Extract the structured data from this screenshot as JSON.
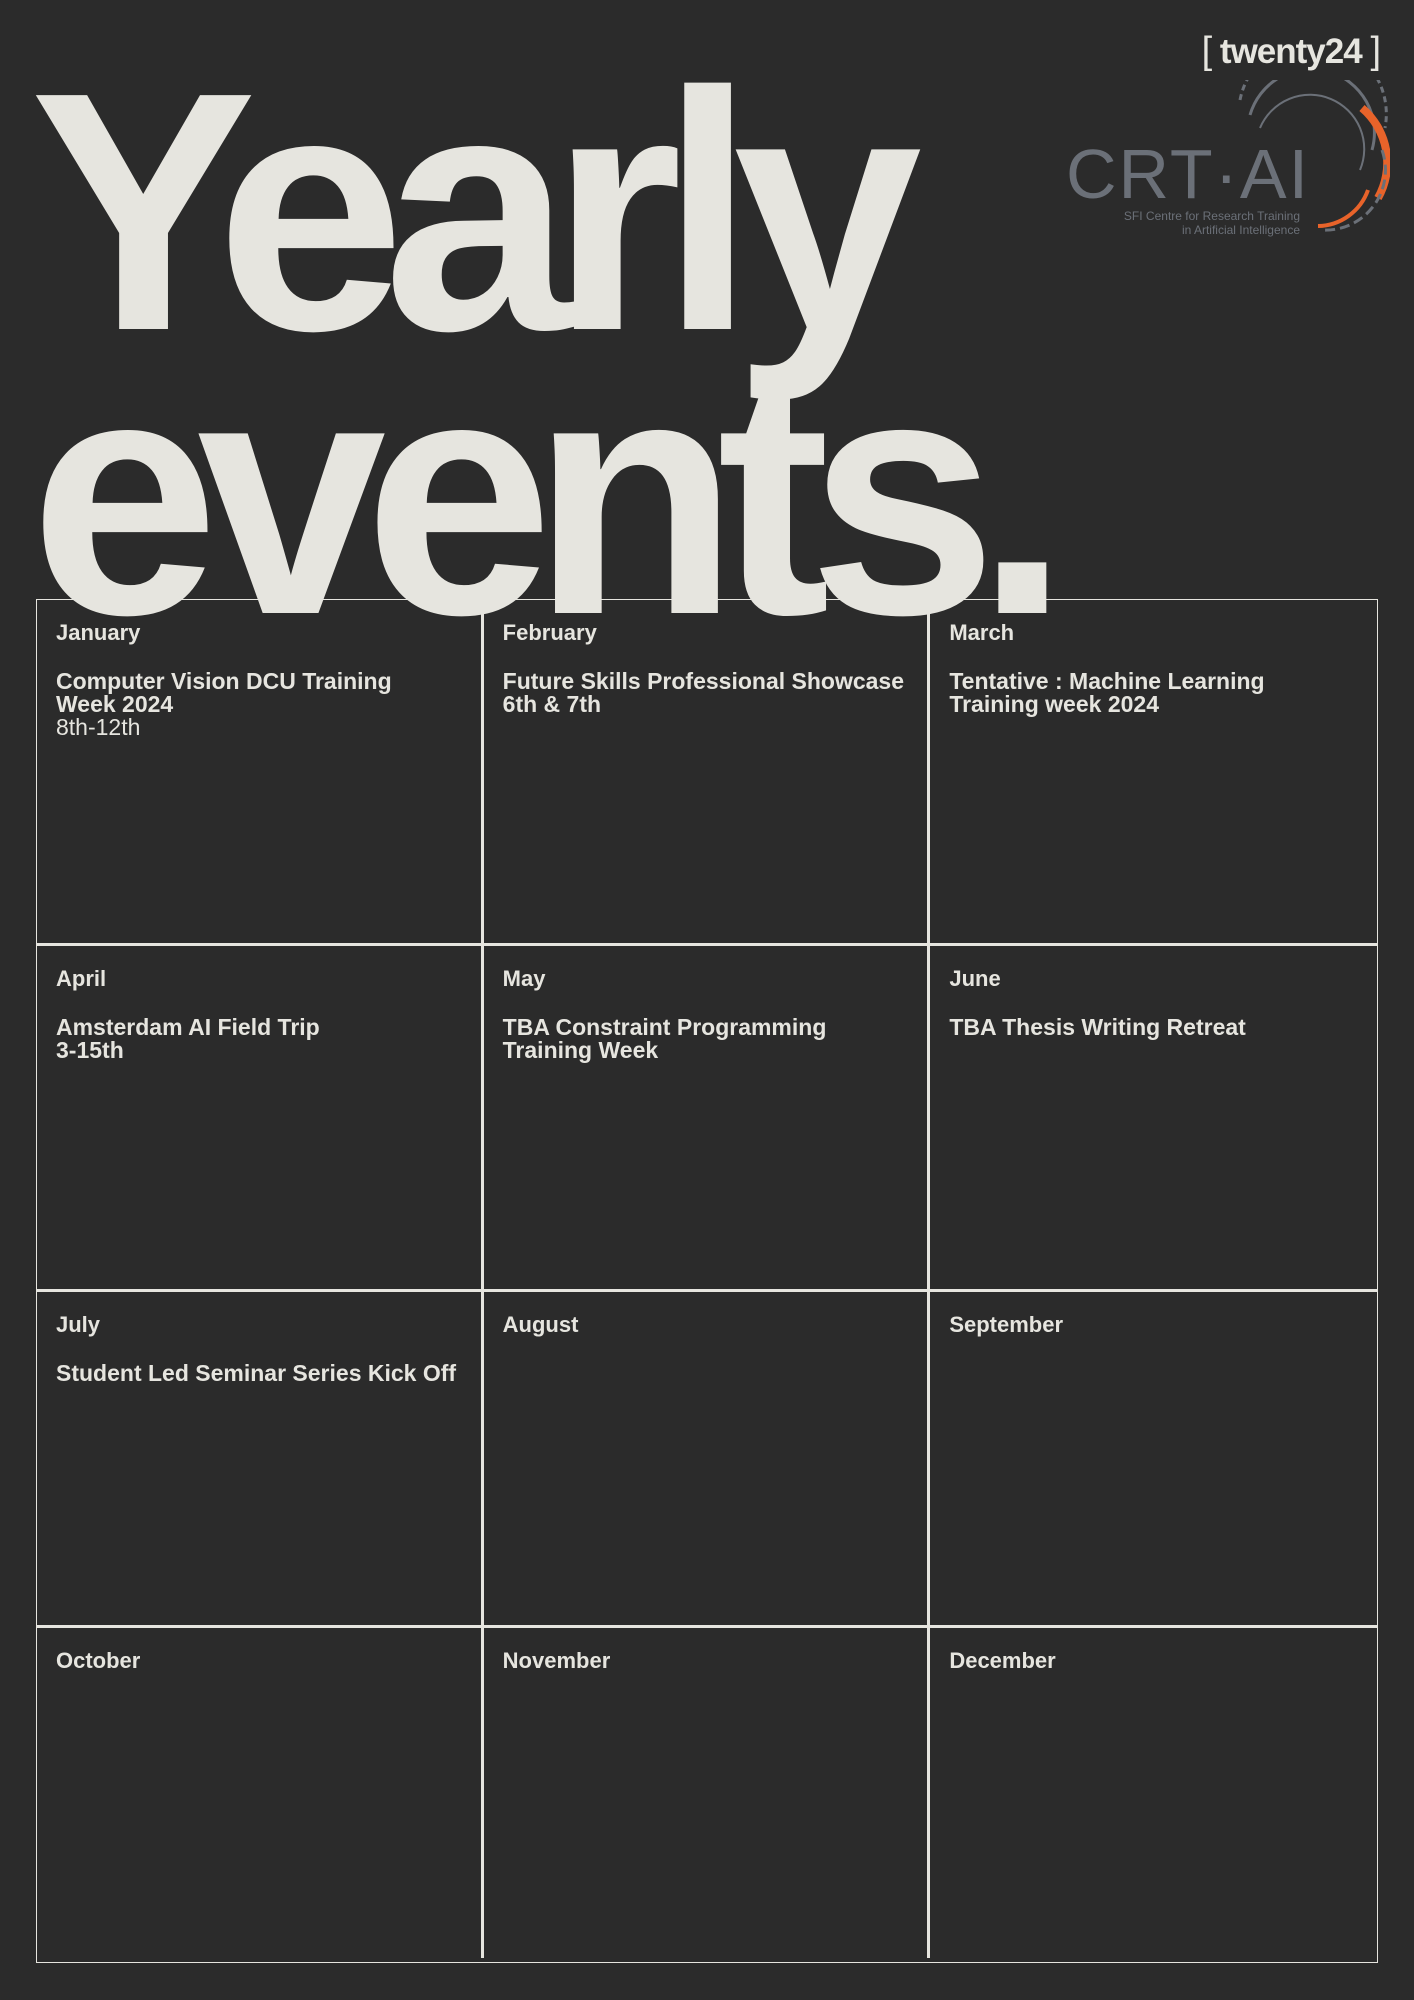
{
  "header": {
    "year_tag_open": "[",
    "year_tag": "twenty24",
    "year_tag_close": "]",
    "title_line1": "Yearly",
    "title_line2": "events."
  },
  "logo": {
    "name": "CRT·AI",
    "subtitle_line1": "SFI Centre for Research Training",
    "subtitle_line2": "in Artificial Intelligence",
    "accent_color": "#e8632a",
    "logo_color": "#6b7078"
  },
  "colors": {
    "background": "#2b2b2b",
    "foreground": "#e6e5df"
  },
  "months": [
    {
      "month": "January",
      "event": "Computer Vision DCU Training\nWeek 2024",
      "date": "8th-12th"
    },
    {
      "month": "February",
      "event": "Future Skills Professional Showcase\n6th & 7th",
      "date": ""
    },
    {
      "month": "March",
      "event": "Tentative : Machine Learning\nTraining week 2024",
      "date": ""
    },
    {
      "month": "April",
      "event": "Amsterdam AI Field Trip\n3-15th",
      "date": ""
    },
    {
      "month": "May",
      "event": "TBA Constraint Programming\nTraining Week",
      "date": ""
    },
    {
      "month": "June",
      "event": "TBA Thesis Writing Retreat",
      "date": ""
    },
    {
      "month": "July",
      "event": "Student Led Seminar Series Kick Off",
      "date": ""
    },
    {
      "month": "August",
      "event": "",
      "date": ""
    },
    {
      "month": "September",
      "event": "",
      "date": ""
    },
    {
      "month": "October",
      "event": "",
      "date": ""
    },
    {
      "month": "November",
      "event": "",
      "date": ""
    },
    {
      "month": "December",
      "event": "",
      "date": ""
    }
  ]
}
